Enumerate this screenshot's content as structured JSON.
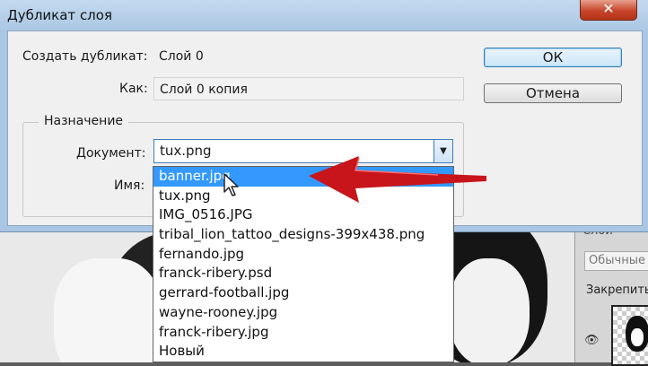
{
  "dialog": {
    "title": "Дубликат слоя",
    "close_icon": "close-icon",
    "duplicate_label": "Создать дубликат:",
    "duplicate_value": "Слой 0",
    "as_label": "Как:",
    "as_value": "Слой 0 копия",
    "destination_title": "Назначение",
    "document_label": "Документ:",
    "document_value": "tux.png",
    "name_label": "Имя:",
    "ok_label": "ОК",
    "cancel_label": "Отмена"
  },
  "dropdown": {
    "items": [
      "banner.jpg",
      "tux.png",
      "IMG_0516.JPG",
      "tribal_lion_tattoo_designs-399x438.png",
      "fernando.jpg",
      "franck-ribery.psd",
      "gerrard-football.jpg",
      "wayne-rooney.jpg",
      "franck-ribery.jpg",
      "Новый"
    ],
    "selected_index": 0
  },
  "layers_panel": {
    "tab": "Слои",
    "blend_mode": "Обычные",
    "lock_label": "Закрепить"
  },
  "colors": {
    "accent": "#3399ff",
    "annotation": "#c8151b"
  }
}
